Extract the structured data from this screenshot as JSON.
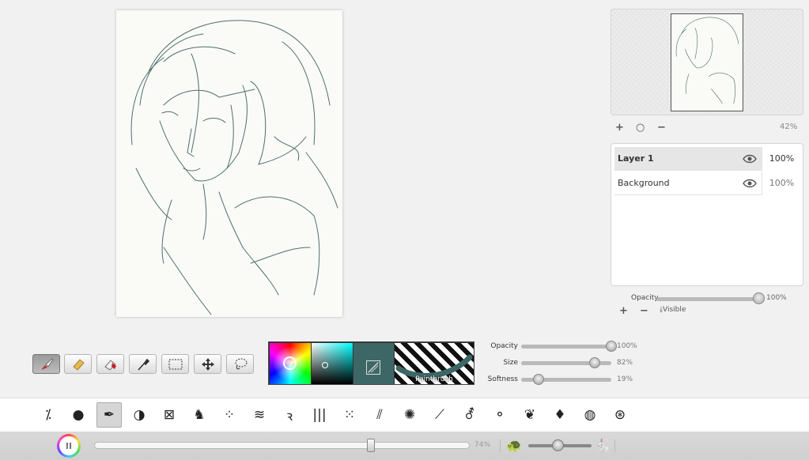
{
  "navigator": {
    "zoom_in": "+",
    "zoom_reset": "○",
    "zoom_out": "−",
    "zoom_value": "42%"
  },
  "layers": {
    "items": [
      {
        "name": "Layer 1",
        "opacity": "100%",
        "active": true
      },
      {
        "name": "Background",
        "opacity": "100%",
        "active": false
      }
    ],
    "opacity_label": "Opacity",
    "opacity_value": "100%",
    "opacity_level": 1.0,
    "add": "+",
    "remove": "−",
    "visible_label": "Visible"
  },
  "tools": [
    "paintbrush-tool",
    "eraser-tool",
    "fill-eraser-tool",
    "eyedropper-tool",
    "rect-select-tool",
    "move-tool",
    "lasso-tool"
  ],
  "color": {
    "current_hex": "#3d6766",
    "brush_name": "Paintbrush"
  },
  "sliders": {
    "opacity": {
      "label": "Opacity",
      "value": "100%",
      "level": 1.0
    },
    "size": {
      "label": "Size",
      "value": "82%",
      "level": 0.82
    },
    "softness": {
      "label": "Softness",
      "value": "19%",
      "level": 0.19
    }
  },
  "brushes": [
    "⁒",
    "●",
    "✒",
    "◑",
    "⊠",
    "♞",
    "⁘",
    "≋",
    "ꝛ",
    "|||",
    "⁙",
    "⫽",
    "✺",
    "⟋",
    "⚦",
    "⚬",
    "❦",
    "♦",
    "◍",
    "⊛"
  ],
  "playback": {
    "progress_value": "74%",
    "progress_level": 0.74,
    "speed_level": 0.45
  }
}
